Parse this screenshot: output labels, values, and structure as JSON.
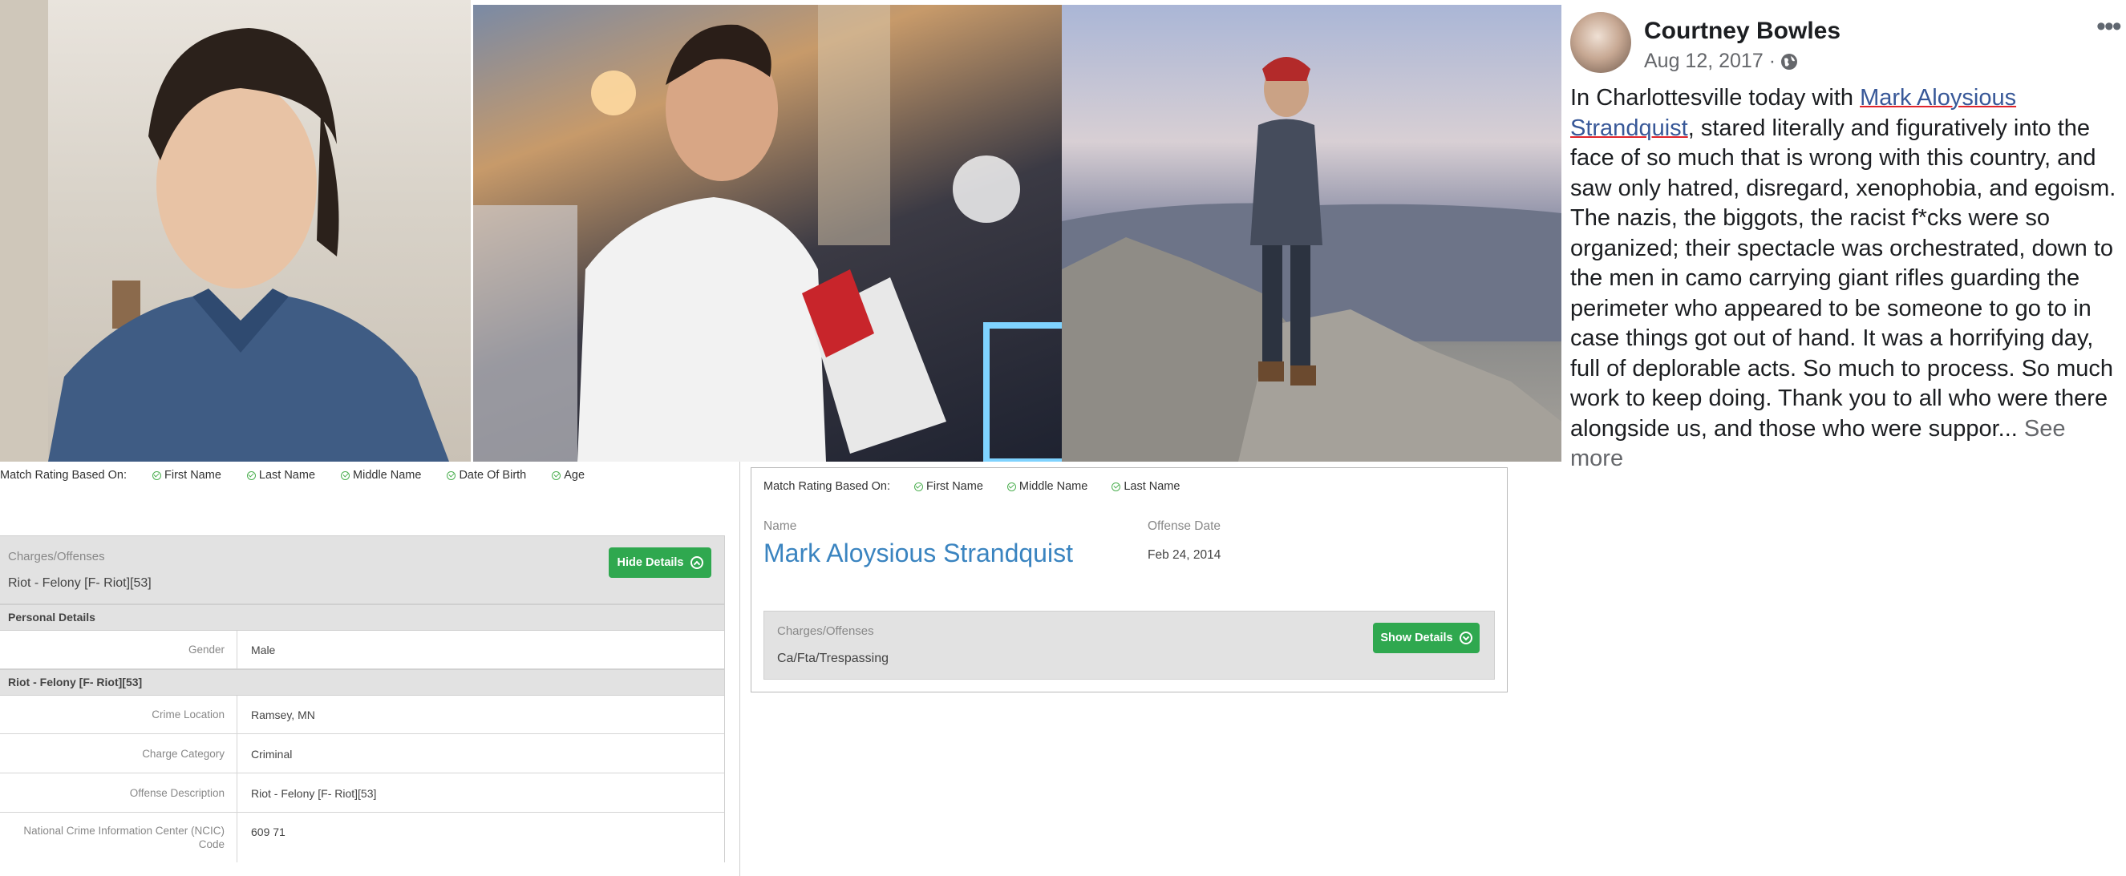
{
  "facebook_post": {
    "author": "Courtney Bowles",
    "date": "Aug 12, 2017 ·",
    "privacy_icon": "globe-icon",
    "more_icon": "ellipsis-icon",
    "text_before": "In Charlottesville today with ",
    "tagged_name": "Mark Aloysious Strandquist",
    "text_after": ", stared literally and figuratively into the face of so much that is wrong with this country, and saw only hatred, disregard, xenophobia, and egoism. The nazis, the biggots, the racist f*cks were so organized; their spectacle was orchestrated, down to the men in camo carrying giant rifles guarding the perimeter who appeared to be someone to go to in case things got out of hand. It was a horrifying day, full of deplorable acts. So much to process. So much work to keep doing. Thank you to all who were there alongside us, and those who were suppor...",
    "see_more": " See more"
  },
  "left_record": {
    "match_label": "Match Rating Based On:",
    "match_fields": [
      "First Name",
      "Last Name",
      "Middle Name",
      "Date Of Birth",
      "Age"
    ],
    "charges_label": "Charges/Offenses",
    "charges_value": "Riot - Felony [F- Riot][53]",
    "toggle_label": "Hide Details",
    "personal_details_heading": "Personal Details",
    "gender_label": "Gender",
    "gender_value": "Male",
    "offense_heading": "Riot - Felony [F- Riot][53]",
    "rows": [
      {
        "label": "Crime Location",
        "value": "Ramsey, MN"
      },
      {
        "label": "Charge Category",
        "value": "Criminal"
      },
      {
        "label": "Offense Description",
        "value": "Riot - Felony [F- Riot][53]"
      },
      {
        "label": "National Crime Information Center (NCIC) Code",
        "value": "609 71"
      }
    ]
  },
  "right_record": {
    "match_label": "Match Rating Based On:",
    "match_fields": [
      "First Name",
      "Middle Name",
      "Last Name"
    ],
    "name_label": "Name",
    "name_value": "Mark Aloysious Strandquist",
    "offense_date_label": "Offense Date",
    "offense_date_value": "Feb 24, 2014",
    "charges_label": "Charges/Offenses",
    "charges_value": "Ca/Fta/Trespassing",
    "toggle_label": "Show Details"
  },
  "colors": {
    "green_button": "#2fa84f",
    "name_blue": "#3a84c0",
    "fb_link": "#385898",
    "panel_gray": "#e2e2e2"
  }
}
